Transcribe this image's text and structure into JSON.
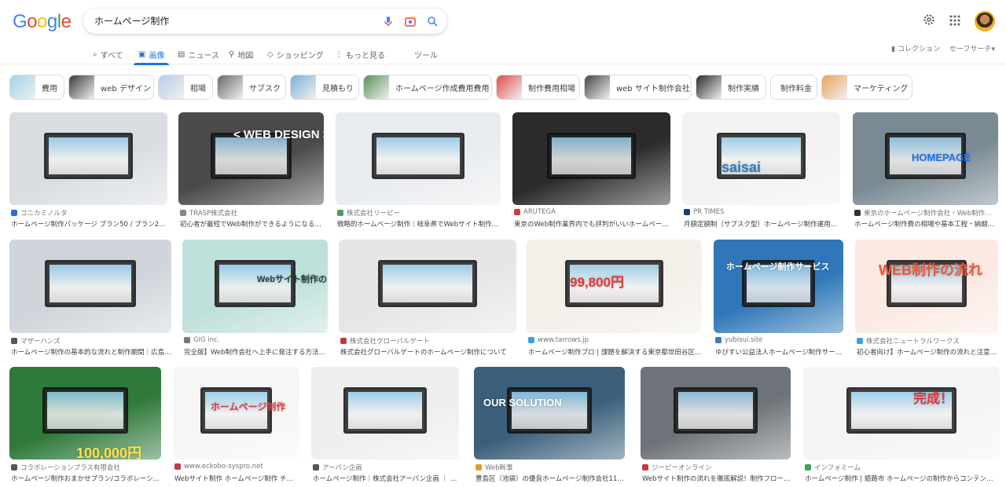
{
  "header": {
    "logo": "Google",
    "logo_colors": [
      "#4285f4",
      "#ea4335",
      "#fbbc05",
      "#4285f4",
      "#34a853",
      "#ea4335"
    ],
    "query": "ホームページ制作",
    "icons": [
      "microphone-icon",
      "camera-icon",
      "search-icon",
      "gear-icon",
      "apps-icon"
    ]
  },
  "tabs": {
    "all": "すべて",
    "images": "画像",
    "news": "ニュース",
    "maps": "地図",
    "shopping": "ショッピング",
    "more": "もっと見る",
    "tools": "ツール",
    "collections": "コレクション",
    "safesearch": "セーフサーチ"
  },
  "chips": [
    {
      "label": "費用",
      "color": "#9ed3e8"
    },
    {
      "label": "web デザイン",
      "color": "#3b3b3b"
    },
    {
      "label": "相場",
      "color": "#b9cbe8"
    },
    {
      "label": "サブスク",
      "color": "#6a6a6a"
    },
    {
      "label": "見積もり",
      "color": "#7ab0d8"
    },
    {
      "label": "ホームページ作成費用費用",
      "color": "#5a8f5a"
    },
    {
      "label": "制作費用相場",
      "color": "#e14b4b"
    },
    {
      "label": "web サイト制作会社",
      "color": "#444"
    },
    {
      "label": "制作実績",
      "color": "#2a2a2a"
    },
    {
      "label": "制作料金",
      "color": ""
    },
    {
      "label": "マーケティング",
      "color": "#e9a25a"
    }
  ],
  "results": [
    {
      "source": "コニカミノルタ",
      "title": "ホームページ制作パッケージ プラン50 / プラン20 /...",
      "bg": "#d9dde2",
      "fav": "#2a6fd1"
    },
    {
      "source": "TRASP株式会社",
      "title": "初心者が最短でWeb制作ができるようになる方...",
      "bg": "#4a4a4a",
      "fav": "#888",
      "overlay": "< WEB DESIGN >"
    },
    {
      "source": "株式会社リーピー",
      "title": "戦略的ホームページ制作｜岐阜県でWebサイト制作な...",
      "bg": "#e9ecef",
      "fav": "#4a9e5c"
    },
    {
      "source": "ARUTEGA",
      "title": "東京のWeb制作業界内でも評判がいいホームページ...",
      "bg": "#2b2b2b",
      "fav": "#d23b3b"
    },
    {
      "source": "PR TIMES",
      "title": "月額定額制（サブスク型）ホームページ制作運用プ...",
      "bg": "#f2f2f2",
      "fav": "#1d3c7a",
      "overlay": "saisai"
    },
    {
      "source": "東京のホームページ制作会社・Web制作会社",
      "title": "ホームページ制作費の相場や基本工程・納期に...",
      "bg": "#7a8a94",
      "fav": "#333",
      "overlay": "HOMEPAGE"
    },
    {
      "source": "マザーハンズ",
      "title": "ホームページ制作の基本的な流れと制作期間｜広島の...",
      "bg": "#cfd5db",
      "fav": "#555"
    },
    {
      "source": "GIG inc.",
      "title": "完全版】Web制作会社へ上手に発注する方法と...",
      "bg": "#bfe0da",
      "fav": "#777",
      "overlay": "Webサイト制作の ポイント"
    },
    {
      "source": "株式会社グローバルゲート",
      "title": "株式会社グローバルゲートのホームページ制作について",
      "bg": "#e6e6e6",
      "fav": "#c23b3b"
    },
    {
      "source": "www.tarrows.jp",
      "title": "ホームページ制作プロ | 課題を解決する東京都世田谷区の...",
      "bg": "#f3efe9",
      "fav": "#3aa3d8",
      "overlay": "99,800円"
    },
    {
      "source": "yubisui.site",
      "title": "ゆびすい公益法人ホームページ制作サービ...",
      "bg": "#2f77b8",
      "fav": "#3a7cc1",
      "overlay": "ホームページ制作サービス"
    },
    {
      "source": "株式会社ニュートラルワークス",
      "title": "初心者向け】ホームページ制作の流れと注意点...",
      "bg": "#fbe9e2",
      "fav": "#3aa3d8",
      "overlay": "WEB制作の流れ"
    },
    {
      "source": "コラボレーションプラス有限会社",
      "title": "ホームページ制作おまかせプラン/コラボレーシ...",
      "bg": "#2f7a3a",
      "fav": "#555",
      "overlay": "100,000円"
    },
    {
      "source": "www.eckobo-syspro.net",
      "title": "Webサイト制作 ホームページ制作 チラシ...",
      "bg": "#f6f6f6",
      "fav": "#c23b3b",
      "overlay": "ホームページ制作"
    },
    {
      "source": "アーバン企画",
      "title": "ホームページ制作｜株式会社アーバン企画 ｜ 横...",
      "bg": "#eeeeee",
      "fav": "#555"
    },
    {
      "source": "Web幹事",
      "title": "豊島区（池袋）の優良ホームページ制作会社11社...",
      "bg": "#3b5f7a",
      "fav": "#e59a2a",
      "overlay": "OUR SOLUTION"
    },
    {
      "source": "ジーピーオンライン",
      "title": "Webサイト制作の流れを徹底解説！制作フローの...",
      "bg": "#6d7378",
      "fav": "#c23b3b"
    },
    {
      "source": "インフォミーム",
      "title": "ホームページ制作 | 姫路市 ホームページの制作からコンテンツの...",
      "bg": "#f4f4f4",
      "fav": "#34a853",
      "overlay": "完成！"
    }
  ]
}
